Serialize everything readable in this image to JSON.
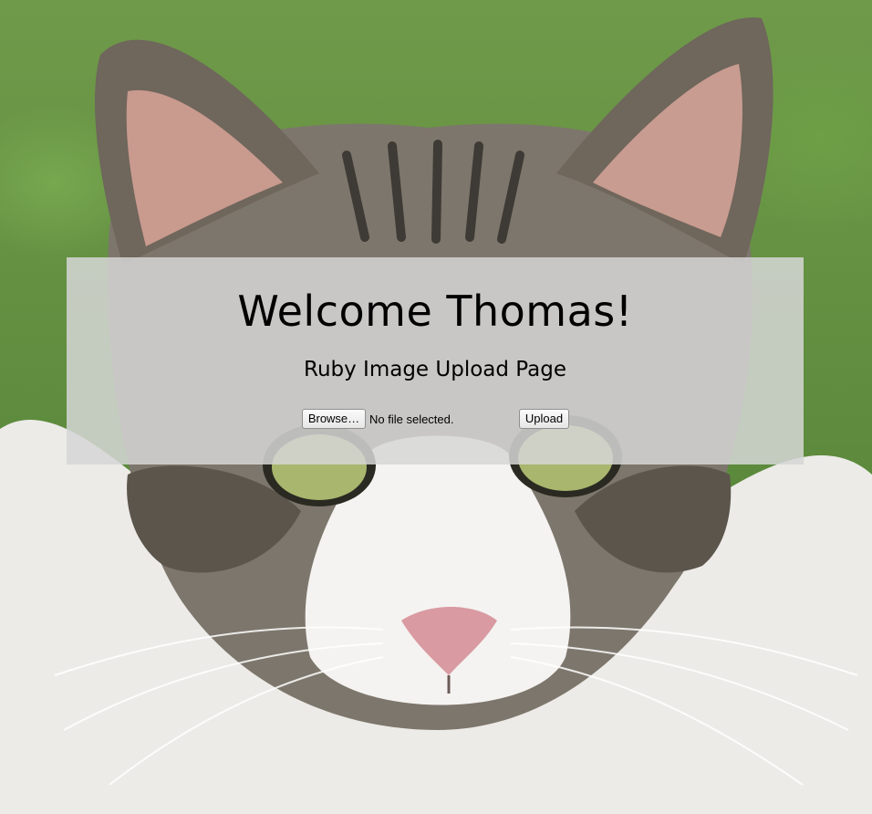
{
  "page": {
    "title": "Welcome Thomas!",
    "subtitle": "Ruby Image Upload Page"
  },
  "upload_form": {
    "browse_label": "Browse…",
    "file_status": "No file selected.",
    "upload_label": "Upload"
  },
  "colors": {
    "panel_background": "#d6d6d6",
    "text": "#000000",
    "grass": "#5e8a3c"
  },
  "background": {
    "subject": "tabby-and-white-cat-photo"
  }
}
